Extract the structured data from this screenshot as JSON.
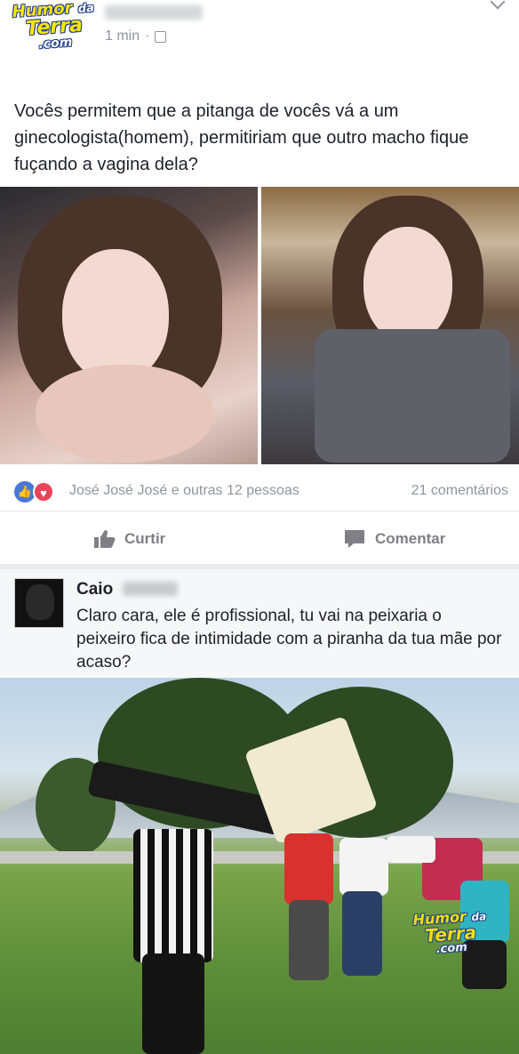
{
  "post": {
    "time": "1 min",
    "text": "Vocês permitem que a pitanga de vocês vá a um ginecologista(homem), permitiriam que outro macho fique fuçando a vagina dela?",
    "reactions_text": "José José José e outras 12 pessoas",
    "comments_count": "21 comentários",
    "like_label": "Curtir",
    "comment_label": "Comentar"
  },
  "comment": {
    "author": "Caio",
    "text": "Claro cara, ele é profissional, tu vai na peixaria o peixeiro fica de intimidade com a piranha da tua mãe por acaso?"
  },
  "watermark": {
    "line1": "Humor",
    "line2": "da",
    "line3": "Terra",
    "line4": ".com"
  },
  "colors": {
    "like_blue": "#4a78d6",
    "love_red": "#e9445a",
    "muted_text": "#90949c"
  }
}
